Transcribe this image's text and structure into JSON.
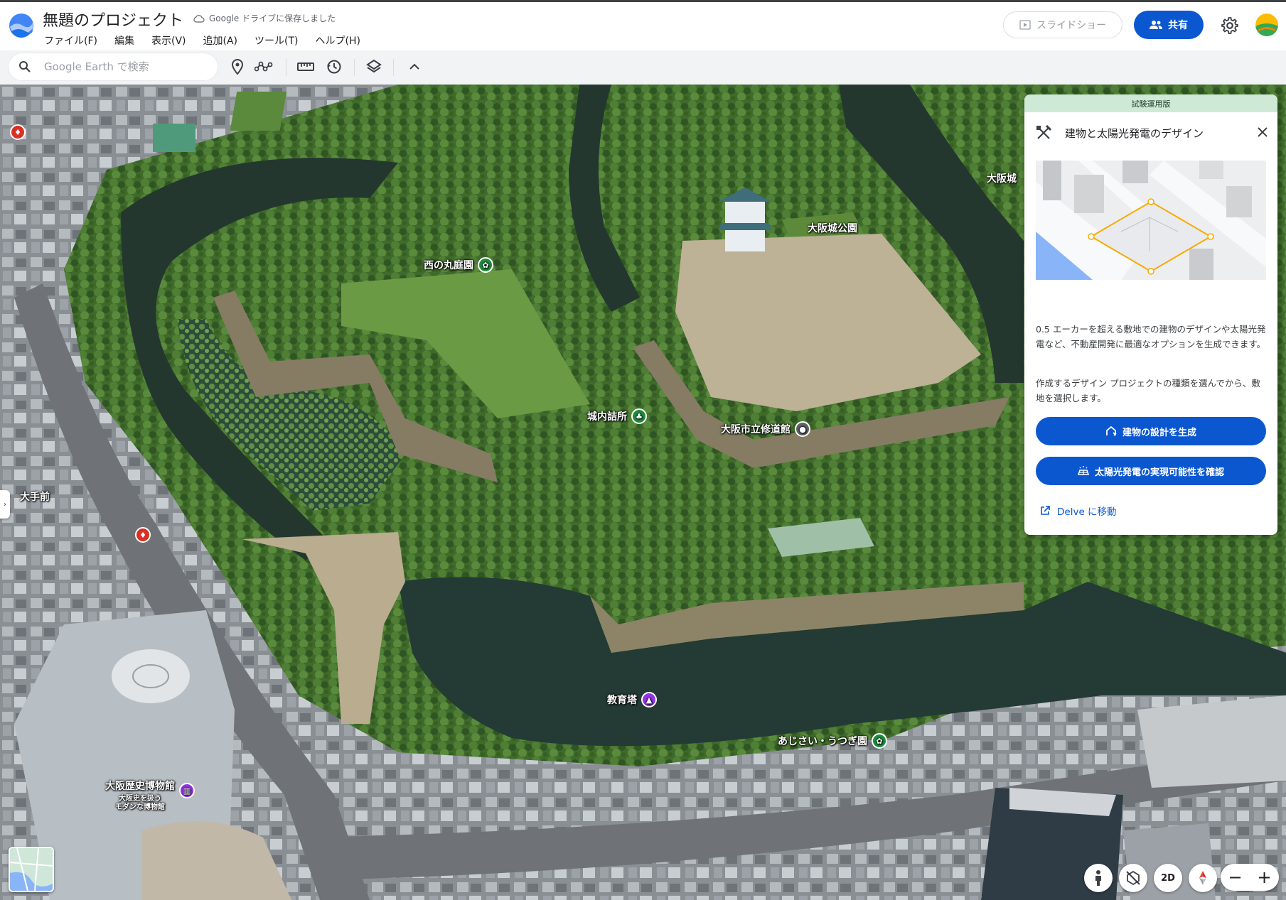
{
  "header": {
    "project_title": "無題のプロジェクト",
    "saved_status": "Google ドライブに保存しました",
    "menu": [
      "ファイル(F)",
      "編集",
      "表示(V)",
      "追加(A)",
      "ツール(T)",
      "ヘルプ(H)"
    ],
    "slideshow_label": "スライドショー",
    "share_label": "共有"
  },
  "toolbar": {
    "search_placeholder": "Google Earth で検索",
    "tools": [
      "add-placemark-icon",
      "draw-path-icon",
      "measure-icon",
      "history-icon",
      "layers-icon",
      "collapse-icon"
    ]
  },
  "map": {
    "labels": {
      "nishinomaru": "西の丸庭園",
      "osakajo_park": "大阪城公園",
      "jonai": "城内詰所",
      "shuudoukan": "大阪市立修道館",
      "otemae": "大手前",
      "kyouikutou": "教育塔",
      "ajisai": "あじさい・うつぎ園",
      "museum": "大阪歴史博物館",
      "museum_sub": "大阪史を扱う\nモダンな博物館",
      "osakajo_edge": "大阪城"
    }
  },
  "panel": {
    "badge": "試験運用版",
    "title": "建物と太陽光発電のデザイン",
    "text1": "0.5 エーカーを超える敷地での建物のデザインや太陽光発電など、不動産開発に最適なオプションを生成できます。",
    "text2": "作成するデザイン プロジェクトの種類を選んでから、敷地を選択します。",
    "btn_building": "建物の設計を生成",
    "btn_solar": "太陽光発電の実現可能性を確認",
    "link_delve": "Delve に移動"
  },
  "controls": {
    "view_2d": "2D",
    "zoom_out": "−",
    "zoom_in": "+"
  },
  "colors": {
    "accent": "#0b57d0",
    "badge_bg": "#ceead6"
  }
}
